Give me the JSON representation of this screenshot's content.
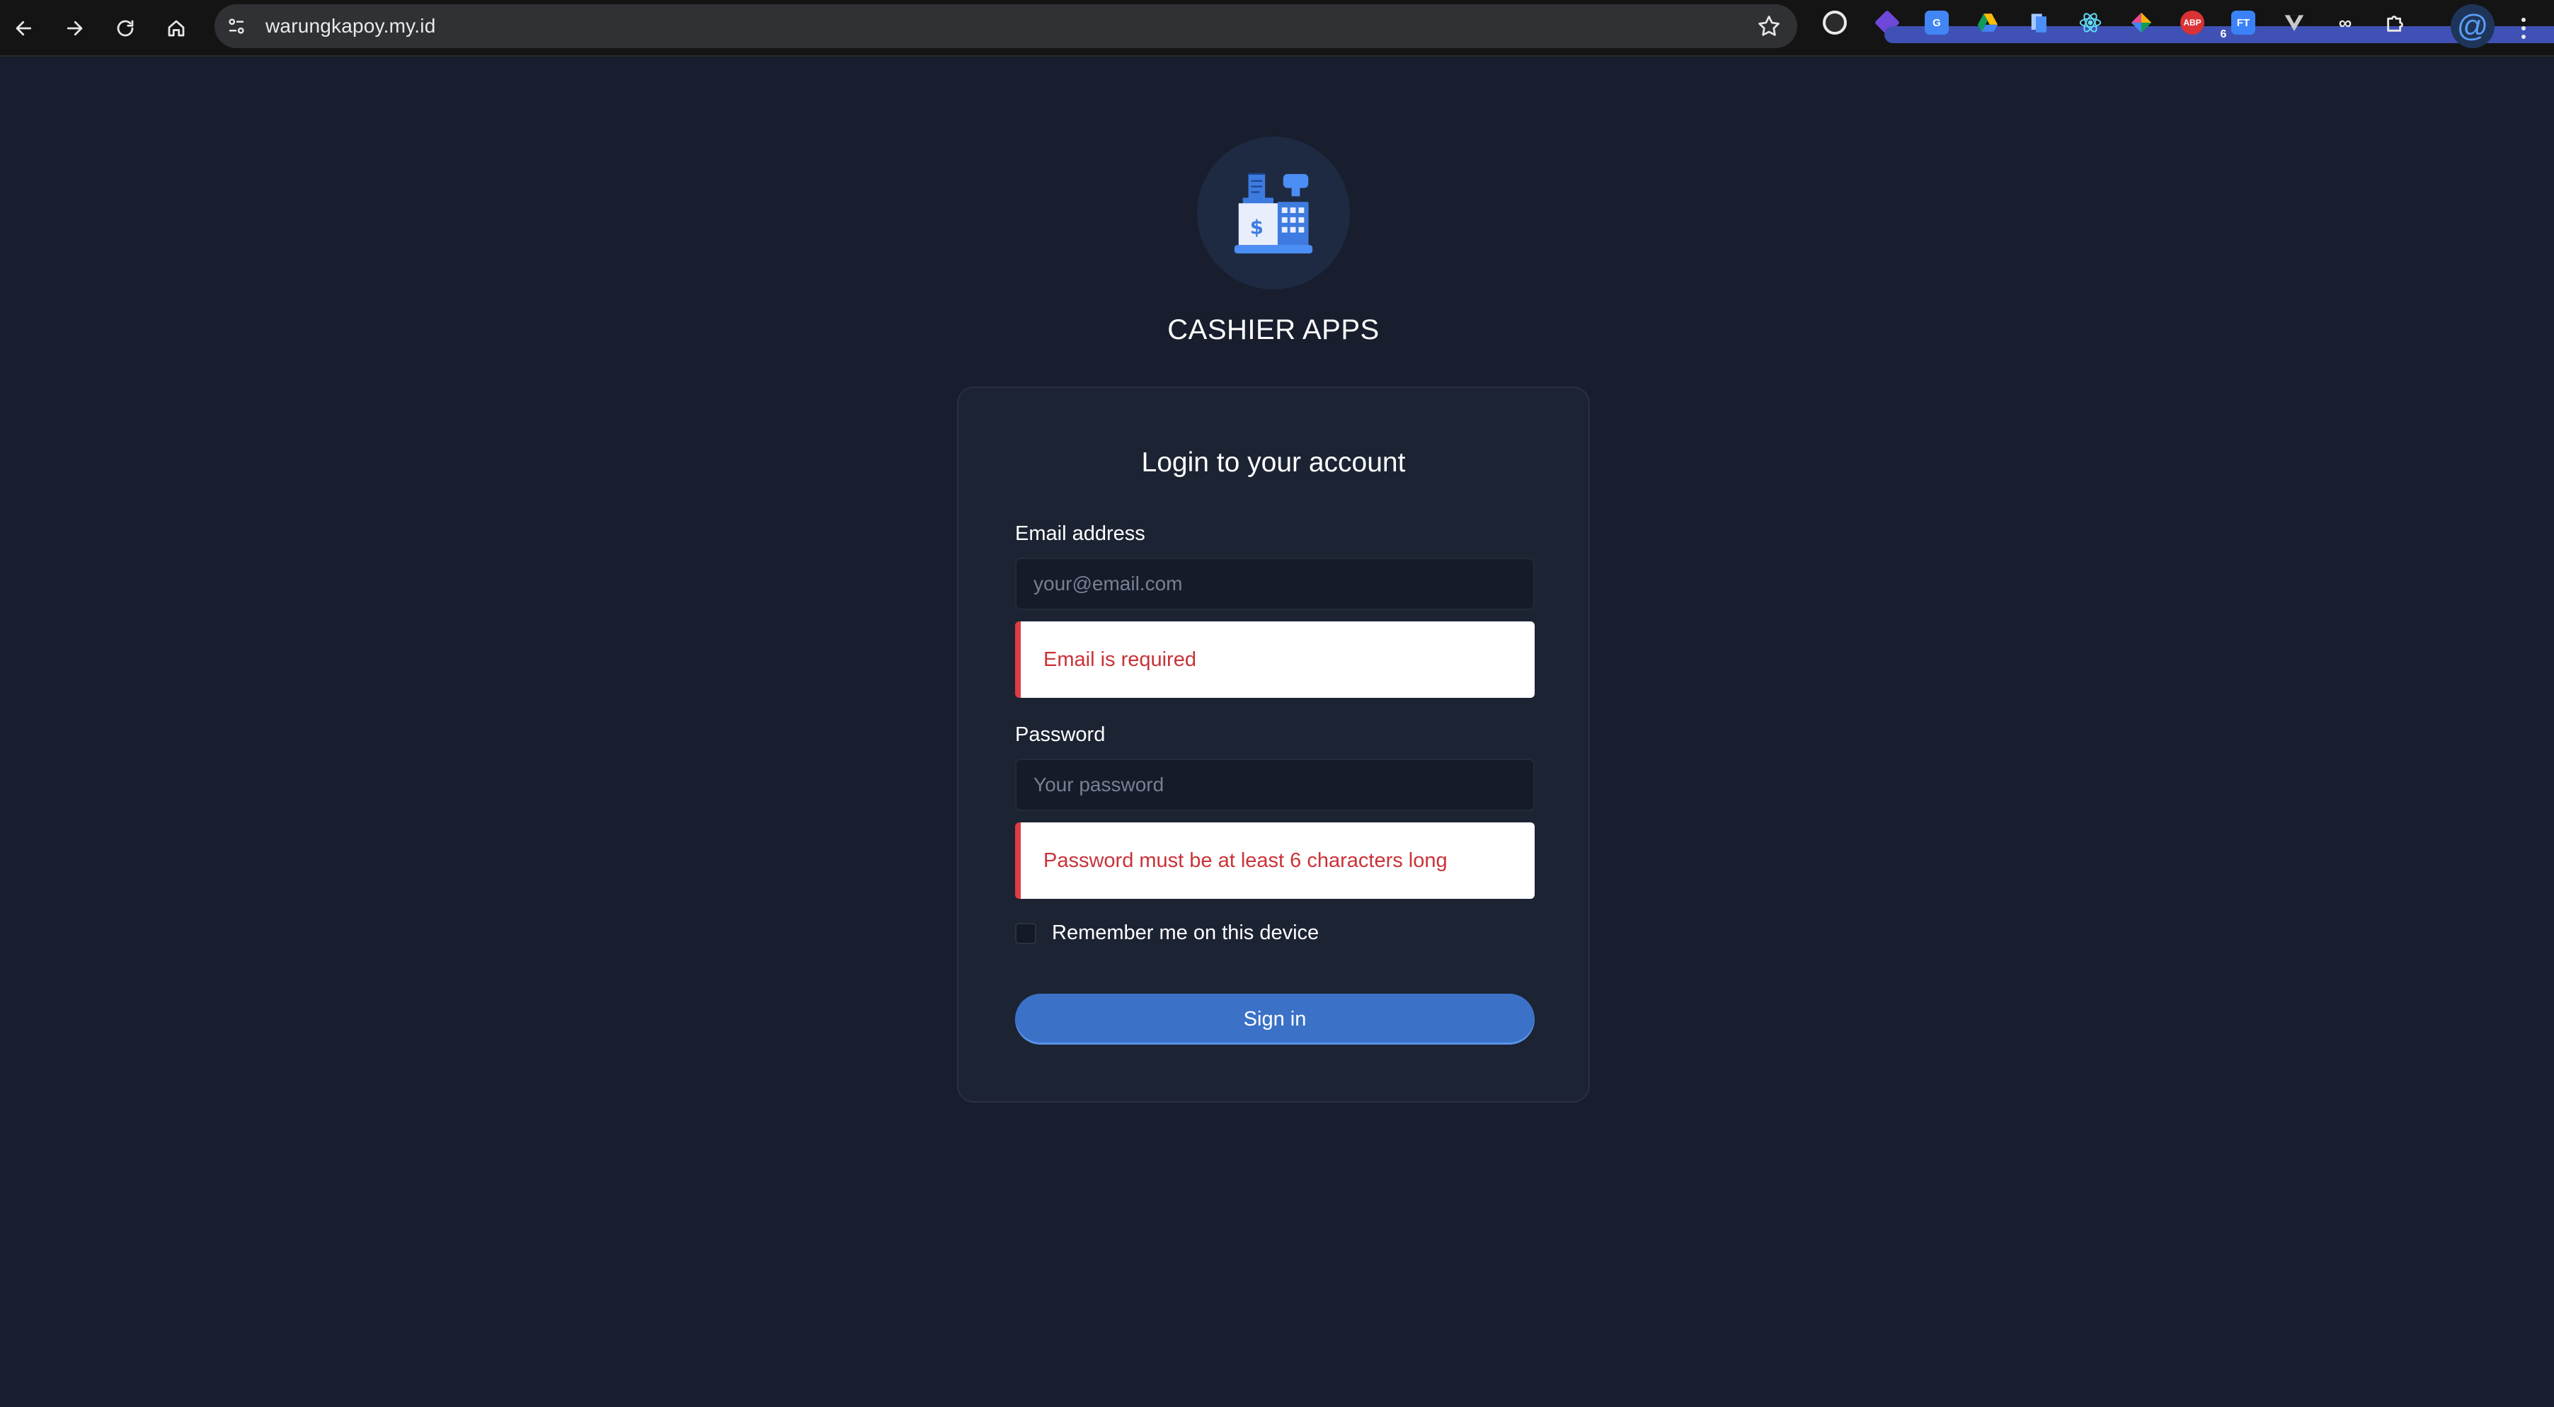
{
  "browser": {
    "url": "warungkapoy.my.id",
    "extensions": [
      {
        "icon": "color-circle-icon",
        "label": "",
        "color": "#e8eaed"
      },
      {
        "icon": "extension-gem-icon",
        "label": "",
        "badge": "6",
        "color": "#6e48d8"
      },
      {
        "icon": "translate-icon",
        "label": "G",
        "color": "#4285f4"
      },
      {
        "icon": "google-drive-icon",
        "label": "",
        "color": "#fbbc04"
      },
      {
        "icon": "docs-icon",
        "label": "",
        "color": "#4b8ef5"
      },
      {
        "icon": "react-devtools-icon",
        "label": "",
        "color": "#61dafb"
      },
      {
        "icon": "color-picker-icon",
        "label": "",
        "color": "#e84a8a"
      },
      {
        "icon": "adblock-plus-icon",
        "label": "ABP",
        "color": "#d93235"
      },
      {
        "icon": "ft-icon",
        "label": "FT",
        "color": "#3b82f6"
      },
      {
        "icon": "vue-devtools-icon",
        "label": "",
        "color": "#c8c8c8"
      },
      {
        "icon": "infinity-icon",
        "label": "",
        "color": "#e6e6e6"
      },
      {
        "icon": "puzzle-icon",
        "label": "",
        "color": "#e6e6e6"
      }
    ]
  },
  "app": {
    "logo": "cash-register-icon",
    "title": "CASHIER APPS"
  },
  "login": {
    "heading": "Login to your account",
    "email_label": "Email address",
    "email_placeholder": "your@email.com",
    "email_value": "",
    "email_error": "Email is required",
    "password_label": "Password",
    "password_placeholder": "Your password",
    "password_value": "",
    "password_error": "Password must be at least 6 characters long",
    "remember_label": "Remember me on this device",
    "remember_checked": false,
    "submit_label": "Sign in"
  },
  "colors": {
    "page_background": "#181e2d",
    "card_background": "#1c2333",
    "accent": "#3b72c8",
    "error": "#dc3d45"
  }
}
